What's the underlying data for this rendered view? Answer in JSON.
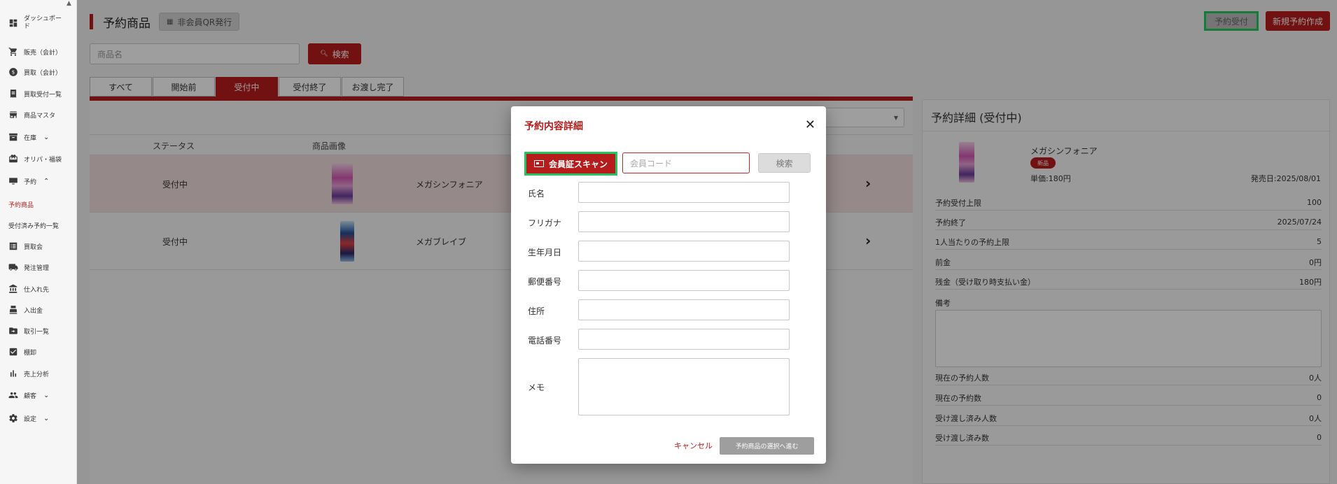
{
  "sidebar": {
    "items": [
      {
        "label": "ダッシュボード",
        "icon": "dashboard-icon"
      },
      {
        "label": "販売（会計）",
        "icon": "cart-icon"
      },
      {
        "label": "買取（会計）",
        "icon": "dollar-icon"
      },
      {
        "label": "買取受付一覧",
        "icon": "receipt-icon"
      },
      {
        "label": "商品マスタ",
        "icon": "store-icon"
      },
      {
        "label": "在庫",
        "icon": "inventory-icon",
        "chevron": "⌄"
      },
      {
        "label": "オリパ・福袋",
        "icon": "gift-icon"
      },
      {
        "label": "予約",
        "icon": "monitor-icon",
        "chevron": "⌃"
      },
      {
        "label": "買取会",
        "icon": "list-icon"
      },
      {
        "label": "発注管理",
        "icon": "truck-icon"
      },
      {
        "label": "仕入れ先",
        "icon": "bank-icon"
      },
      {
        "label": "入出金",
        "icon": "register-icon"
      },
      {
        "label": "取引一覧",
        "icon": "folder-icon"
      },
      {
        "label": "棚卸",
        "icon": "checkbox-icon"
      },
      {
        "label": "売上分析",
        "icon": "bar-chart-icon"
      },
      {
        "label": "顧客",
        "icon": "people-icon",
        "chevron": "⌄"
      },
      {
        "label": "設定",
        "icon": "gear-icon",
        "chevron": "⌄"
      }
    ],
    "sub_items": [
      "予約商品",
      "受付済み予約一覧"
    ]
  },
  "header": {
    "title": "予約商品",
    "qr_button": "非会員QR発行",
    "accept_button": "予約受付",
    "new_button": "新規予約作成"
  },
  "search": {
    "placeholder": "商品名",
    "button": "検索"
  },
  "tabs": [
    "すべて",
    "開始前",
    "受付中",
    "受付終了",
    "お渡し完了"
  ],
  "table": {
    "headers": {
      "status": "ステータス",
      "image": "商品画像"
    },
    "rows": [
      {
        "status": "受付中",
        "name": "メガシンフォニア",
        "arrow": "›"
      },
      {
        "status": "受付中",
        "name": "メガブレイブ",
        "arrow": "›"
      }
    ]
  },
  "detail": {
    "title": "予約詳細 (受付中)",
    "product_name": "メガシンフォニア",
    "badge": "新品",
    "price": "単価:180円",
    "release": "発売日:2025/08/01",
    "rows": [
      {
        "label": "予約受付上限",
        "value": "100"
      },
      {
        "label": "予約終了",
        "value": "2025/07/24"
      },
      {
        "label": "1人当たりの予約上限",
        "value": "5"
      },
      {
        "label": "前金",
        "value": "0円"
      },
      {
        "label": "残金（受け取り時支払い金）",
        "value": "180円"
      }
    ],
    "memo_label": "備考",
    "stats": [
      {
        "label": "現在の予約人数",
        "value": "0人"
      },
      {
        "label": "現在の予約数",
        "value": "0"
      },
      {
        "label": "受け渡し済み人数",
        "value": "0人"
      },
      {
        "label": "受け渡し済み数",
        "value": "0"
      }
    ]
  },
  "modal": {
    "title": "予約内容詳細",
    "close": "✕",
    "scan_button": "会員証スキャン",
    "code_placeholder": "会員コード",
    "search_button": "検索",
    "fields": [
      "氏名",
      "フリガナ",
      "生年月日",
      "郵便番号",
      "住所",
      "電話番号"
    ],
    "memo_label": "メモ",
    "cancel": "キャンセル",
    "next": "予約商品の選択へ進む"
  },
  "colors": {
    "accent": "#b71c1c",
    "highlight": "#22c55e"
  }
}
